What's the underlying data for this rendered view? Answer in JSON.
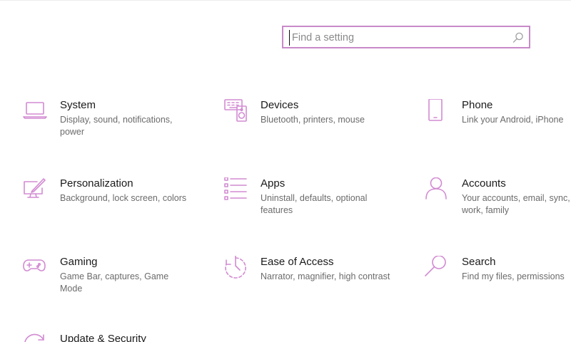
{
  "search": {
    "placeholder": "Find a setting",
    "icon": "search-icon"
  },
  "accent": "#d28bd2",
  "items": [
    {
      "id": "system",
      "title": "System",
      "desc": "Display, sound, notifications, power",
      "icon": "laptop-icon"
    },
    {
      "id": "devices",
      "title": "Devices",
      "desc": "Bluetooth, printers, mouse",
      "icon": "keyboard-speaker-icon"
    },
    {
      "id": "phone",
      "title": "Phone",
      "desc": "Link your Android, iPhone",
      "icon": "phone-icon"
    },
    {
      "id": "personalization",
      "title": "Personalization",
      "desc": "Background, lock screen, colors",
      "icon": "paintbrush-screen-icon"
    },
    {
      "id": "apps",
      "title": "Apps",
      "desc": "Uninstall, defaults, optional features",
      "icon": "apps-list-icon"
    },
    {
      "id": "accounts",
      "title": "Accounts",
      "desc": "Your accounts, email, sync, work, family",
      "icon": "person-icon"
    },
    {
      "id": "gaming",
      "title": "Gaming",
      "desc": "Game Bar, captures, Game Mode",
      "icon": "gamepad-icon"
    },
    {
      "id": "ease",
      "title": "Ease of Access",
      "desc": "Narrator, magnifier, high contrast",
      "icon": "ease-of-access-icon"
    },
    {
      "id": "search",
      "title": "Search",
      "desc": "Find my files, permissions",
      "icon": "magnifier-icon"
    },
    {
      "id": "update",
      "title": "Update & Security",
      "desc": "",
      "icon": "sync-icon"
    }
  ]
}
